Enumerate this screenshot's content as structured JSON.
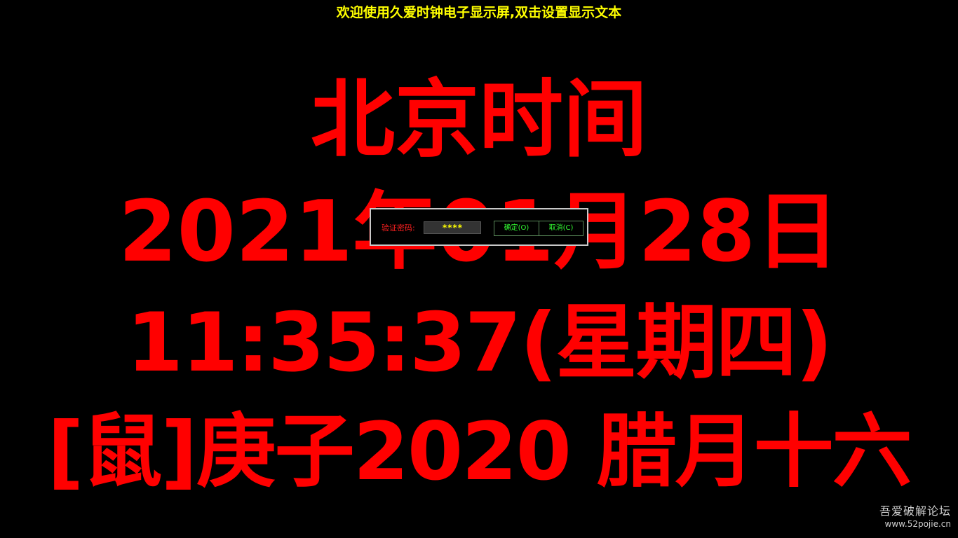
{
  "banner": {
    "text": "欢迎使用久爱时钟电子显示屏,双击设置显示文本",
    "color": "#ffff00"
  },
  "clock": {
    "color": "#ff0000",
    "line1": "北京时间",
    "line2": "2021年01月28日",
    "line3": "11:35:37(星期四)",
    "line4": "[鼠]庚子2020 腊月十六"
  },
  "password_dialog": {
    "label": "验证密码:",
    "value": "****",
    "ok_label": "确定(O)",
    "cancel_label": "取消(C)"
  },
  "watermark": {
    "title": "吾爱破解论坛",
    "url": "www.52pojie.cn"
  }
}
